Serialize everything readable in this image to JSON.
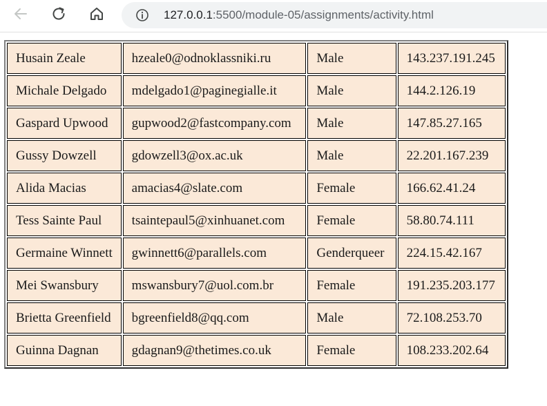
{
  "browser": {
    "url_prefix": "127.0.0.1",
    "url_rest": ":5500/module-05/assignments/activity.html"
  },
  "table": {
    "rows": [
      {
        "name": "Husain Zeale",
        "email": "hzeale0@odnoklassniki.ru",
        "gender": "Male",
        "ip": "143.237.191.245"
      },
      {
        "name": "Michale Delgado",
        "email": "mdelgado1@paginegialle.it",
        "gender": "Male",
        "ip": "144.2.126.19"
      },
      {
        "name": "Gaspard Upwood",
        "email": "gupwood2@fastcompany.com",
        "gender": "Male",
        "ip": "147.85.27.165"
      },
      {
        "name": "Gussy Dowzell",
        "email": "gdowzell3@ox.ac.uk",
        "gender": "Male",
        "ip": "22.201.167.239"
      },
      {
        "name": "Alida Macias",
        "email": "amacias4@slate.com",
        "gender": "Female",
        "ip": "166.62.41.24"
      },
      {
        "name": "Tess Sainte Paul",
        "email": "tsaintepaul5@xinhuanet.com",
        "gender": "Female",
        "ip": "58.80.74.111"
      },
      {
        "name": "Germaine Winnett",
        "email": "gwinnett6@parallels.com",
        "gender": "Genderqueer",
        "ip": "224.15.42.167"
      },
      {
        "name": "Mei Swansbury",
        "email": "mswansbury7@uol.com.br",
        "gender": "Female",
        "ip": "191.235.203.177"
      },
      {
        "name": "Brietta Greenfield",
        "email": "bgreenfield8@qq.com",
        "gender": "Male",
        "ip": "72.108.253.70"
      },
      {
        "name": "Guinna Dagnan",
        "email": "gdagnan9@thetimes.co.uk",
        "gender": "Female",
        "ip": "108.233.202.64"
      }
    ]
  },
  "colors": {
    "cell_background": "#fbe9d8",
    "cell_border": "#000000"
  },
  "icons": {
    "back": "back-arrow-icon",
    "reload": "reload-icon",
    "home": "home-icon",
    "site_info": "info-icon"
  }
}
